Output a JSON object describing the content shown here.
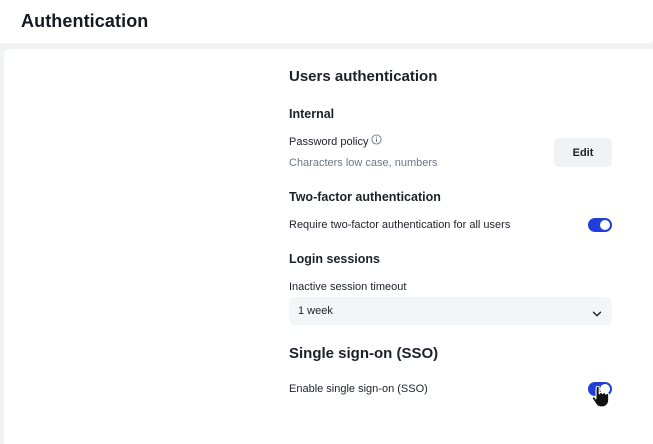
{
  "header": {
    "title": "Authentication"
  },
  "users_auth": {
    "title": "Users authentication",
    "internal": {
      "title": "Internal",
      "password_policy_label": "Password policy",
      "password_policy_desc": "Characters low case, numbers",
      "edit_label": "Edit",
      "icon": "info-icon"
    },
    "two_factor": {
      "title": "Two-factor authentication",
      "require_label": "Require two-factor authentication for all users",
      "enabled": true
    },
    "login_sessions": {
      "title": "Login sessions",
      "timeout_label": "Inactive session timeout",
      "timeout_value": "1 week",
      "icon": "chevron-down-icon"
    }
  },
  "sso": {
    "title": "Single sign-on (SSO)",
    "enable_label": "Enable single sign-on (SSO)",
    "enabled": true
  },
  "colors": {
    "accent": "#1f3fd8",
    "background": "#f1f2f4",
    "muted_text": "#6d7685"
  }
}
